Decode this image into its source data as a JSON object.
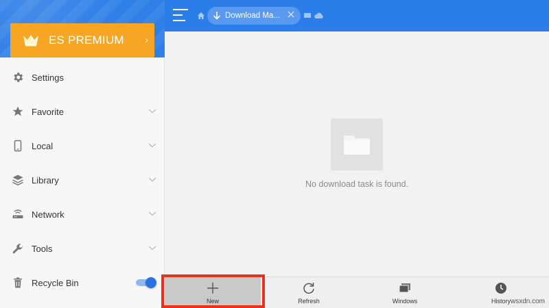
{
  "sidebar": {
    "premium_label": "ES PREMIUM",
    "premium_chevron": "›",
    "items": [
      {
        "label": "Settings",
        "icon": "gear-icon",
        "chevron": false
      },
      {
        "label": "Favorite",
        "icon": "star-icon",
        "chevron": true
      },
      {
        "label": "Local",
        "icon": "phone-icon",
        "chevron": true
      },
      {
        "label": "Library",
        "icon": "layers-icon",
        "chevron": true
      },
      {
        "label": "Network",
        "icon": "router-icon",
        "chevron": true
      },
      {
        "label": "Tools",
        "icon": "wrench-icon",
        "chevron": true
      },
      {
        "label": "Recycle Bin",
        "icon": "trash-icon",
        "toggle_on": true
      }
    ]
  },
  "header": {
    "tab_label": "Download Ma...",
    "icons": [
      "menu-icon",
      "home-icon",
      "download-icon",
      "close-icon",
      "window-icon",
      "cloud-icon"
    ]
  },
  "main": {
    "empty_message": "No download task is found.",
    "empty_icon": "folder-icon"
  },
  "toolbar": {
    "items": [
      {
        "label": "New",
        "icon": "plus-icon",
        "selected": true
      },
      {
        "label": "Refresh",
        "icon": "refresh-icon"
      },
      {
        "label": "Windows",
        "icon": "windows-icon"
      },
      {
        "label": "History",
        "icon": "clock-icon"
      }
    ]
  },
  "watermark": "wsxdn.com",
  "colors": {
    "header_blue": "#2b7de9",
    "premium_orange": "#f6a623",
    "highlight_red": "#e8321c",
    "toggle_blue": "#2a73e0"
  }
}
